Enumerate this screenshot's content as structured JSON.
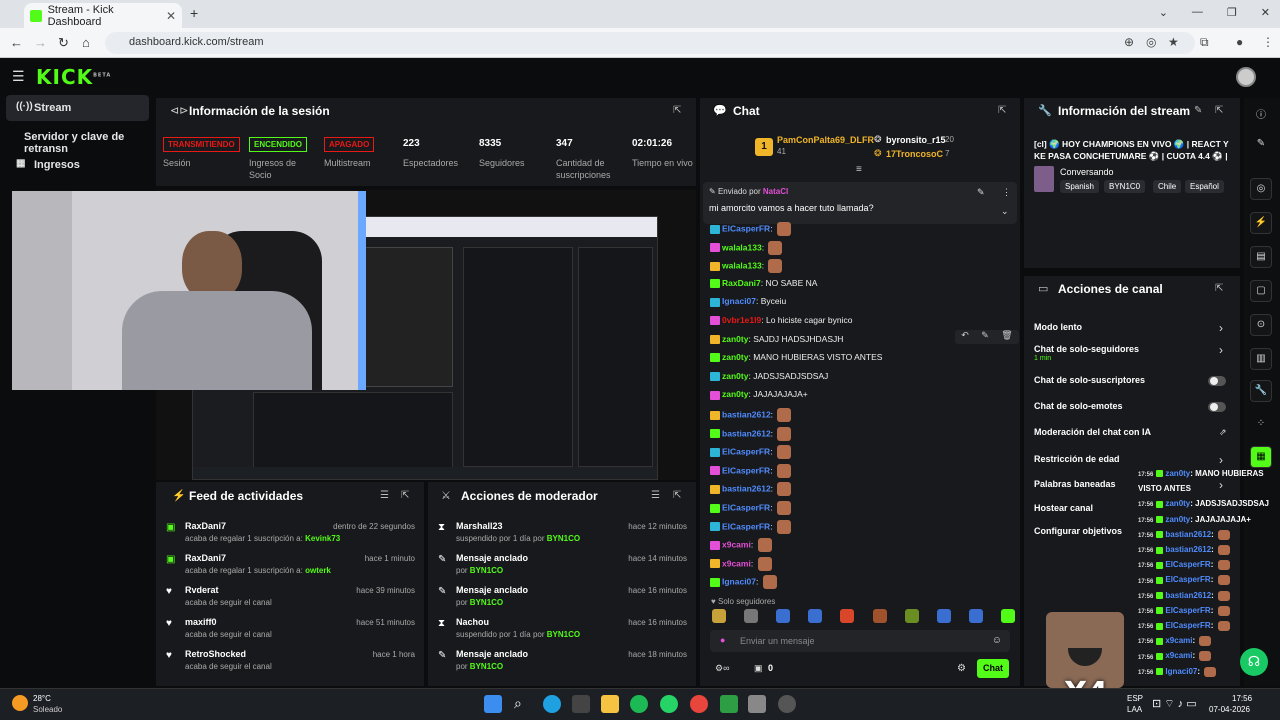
{
  "browser": {
    "tab_title": "Stream - Kick Dashboard",
    "url": "dashboard.kick.com/stream"
  },
  "brand": {
    "logo": "KICK",
    "logo_sup": "BETA",
    "accent": "#53fc18"
  },
  "sidebar": {
    "items": [
      {
        "label": "Stream",
        "icon": "broadcast-icon"
      },
      {
        "label": "Servidor y clave de retransn",
        "icon": ""
      },
      {
        "label": "Ingresos",
        "icon": "grid-icon"
      }
    ]
  },
  "session": {
    "title": "Información de la sesión",
    "stats": [
      {
        "badge": "TRANSMITIENDO",
        "label": "Sesión",
        "color": "#e91916"
      },
      {
        "badge": "ENCENDIDO",
        "label": "Ingresos de Socio",
        "color": "#53fc18"
      },
      {
        "badge": "APAGADO",
        "label": "Multistream",
        "color": "#e91916"
      },
      {
        "value": "223",
        "label": "Espectadores"
      },
      {
        "value": "8335",
        "label": "Seguidores"
      },
      {
        "value": "347",
        "label": "Cantidad de suscripciones"
      },
      {
        "value": "02:01:26",
        "label": "Tiempo en vivo"
      }
    ]
  },
  "feed": {
    "title": "Feed de actividades",
    "items": [
      {
        "name": "RaxDani7",
        "desc": "acaba de regalar 1 suscripción a:",
        "target": "Kevink73",
        "time": "dentro de 22 segundos",
        "icon": "gift-icon"
      },
      {
        "name": "RaxDani7",
        "desc": "acaba de regalar 1 suscripción a:",
        "target": "owterk",
        "time": "hace 1 minuto",
        "icon": "gift-icon"
      },
      {
        "name": "Rvderat",
        "desc": "acaba de seguir el canal",
        "target": "",
        "time": "hace 39 minutos",
        "icon": "heart-icon"
      },
      {
        "name": "maxiff0",
        "desc": "acaba de seguir el canal",
        "target": "",
        "time": "hace 51 minutos",
        "icon": "heart-icon"
      },
      {
        "name": "RetroShocked",
        "desc": "acaba de seguir el canal",
        "target": "",
        "time": "hace 1 hora",
        "icon": "heart-icon"
      }
    ]
  },
  "moderator": {
    "title": "Acciones de moderador",
    "items": [
      {
        "name": "Marshall23",
        "desc": "suspendido por 1 día por",
        "by": "BYN1CO",
        "time": "hace 12 minutos",
        "icon": "hourglass-icon"
      },
      {
        "name": "Mensaje anclado",
        "desc": "por",
        "by": "BYN1CO",
        "time": "hace 14 minutos",
        "icon": "pin-icon"
      },
      {
        "name": "Mensaje anclado",
        "desc": "por",
        "by": "BYN1CO",
        "time": "hace 16 minutos",
        "icon": "pin-icon"
      },
      {
        "name": "Nachou",
        "desc": "suspendido por 1 día por",
        "by": "BYN1CO",
        "time": "hace 16 minutos",
        "icon": "hourglass-icon"
      },
      {
        "name": "Mensaje anclado",
        "desc": "por",
        "by": "BYN1CO",
        "time": "hace 18 minutos",
        "icon": "pin-icon"
      }
    ]
  },
  "chat": {
    "title": "Chat",
    "gifters": {
      "top": "PamConPalta69_DLFR",
      "top_count": "41",
      "second": "byronsito_r15",
      "second_count": "20",
      "third": "17TroncosoC",
      "third_count": "7",
      "rank": "1"
    },
    "pinned": {
      "label": "Enviado por",
      "user": "NataCl",
      "text": "mi amorcito vamos a hacer tuto llamada?"
    },
    "messages": [
      {
        "user": "ElCasperFR",
        "color": "#4f8cff",
        "text": ""
      },
      {
        "user": "walala133",
        "color": "#53fc18",
        "text": ""
      },
      {
        "user": "walala133",
        "color": "#53fc18",
        "text": ""
      },
      {
        "user": "RaxDani7",
        "color": "#53fc18",
        "text": "NO SABE NA"
      },
      {
        "user": "Ignaci07",
        "color": "#4f8cff",
        "text": "Byceiu"
      },
      {
        "user": "0vbr1e1l9",
        "color": "#e91916",
        "text": "Lo hiciste cagar bynico"
      },
      {
        "user": "zan0ty",
        "color": "#53fc18",
        "text": "SAJDJ HADSJHDASJH"
      },
      {
        "user": "zan0ty",
        "color": "#53fc18",
        "text": "MANO HUBIERAS VISTO ANTES"
      },
      {
        "user": "zan0ty",
        "color": "#53fc18",
        "text": "JADSJSADJSDSAJ"
      },
      {
        "user": "zan0ty",
        "color": "#53fc18",
        "text": "JAJAJAJAJA+"
      },
      {
        "user": "bastian2612",
        "color": "#4f8cff",
        "text": ""
      },
      {
        "user": "bastian2612",
        "color": "#4f8cff",
        "text": ""
      },
      {
        "user": "ElCasperFR",
        "color": "#4f8cff",
        "text": ""
      },
      {
        "user": "ElCasperFR",
        "color": "#4f8cff",
        "text": ""
      },
      {
        "user": "bastian2612",
        "color": "#4f8cff",
        "text": ""
      },
      {
        "user": "ElCasperFR",
        "color": "#4f8cff",
        "text": ""
      },
      {
        "user": "ElCasperFR",
        "color": "#4f8cff",
        "text": ""
      },
      {
        "user": "x9cami",
        "color": "#e34fd6",
        "text": ""
      },
      {
        "user": "x9cami",
        "color": "#e34fd6",
        "text": ""
      },
      {
        "user": "Ignaci07",
        "color": "#4f8cff",
        "text": ""
      }
    ],
    "mode": "Solo seguidores",
    "input_placeholder": "Enviar un mensaje",
    "points": "0",
    "send": "Chat"
  },
  "stream_info": {
    "title": "Información del stream",
    "stream_title": "[cl] 🌍 HOY CHAMPIONS EN VIVO 🌍 | REACT Y KE PASA CONCHETUMARE ⚽ | CUOTA 4.4 ⚽ | ...",
    "category": "Conversando",
    "tags": [
      "Spanish",
      "BYN1C0",
      "Chile",
      "Español"
    ]
  },
  "channel_actions": {
    "title": "Acciones de canal",
    "items": [
      {
        "label": "Modo lento",
        "type": "arrow",
        "sub": ""
      },
      {
        "label": "Chat de solo-seguidores",
        "type": "arrow",
        "sub": "1 min"
      },
      {
        "label": "Chat de solo-suscriptores",
        "type": "toggle",
        "sub": ""
      },
      {
        "label": "Chat de solo-emotes",
        "type": "toggle",
        "sub": ""
      },
      {
        "label": "Moderación del chat con IA",
        "type": "link",
        "sub": ""
      },
      {
        "label": "Restricción de edad",
        "type": "arrow",
        "sub": ""
      },
      {
        "label": "Palabras baneadas",
        "type": "arrow",
        "sub": ""
      },
      {
        "label": "Hostear canal",
        "type": "none",
        "sub": ""
      },
      {
        "label": "Configurar objetivos",
        "type": "none",
        "sub": ""
      }
    ]
  },
  "overlay_chat": [
    {
      "user": "zan0ty",
      "text": "MANO HUBIERAS"
    },
    {
      "user": "",
      "text": "VISTO ANTES"
    },
    {
      "user": "zan0ty",
      "text": "JADSJSADJSDSAJ"
    },
    {
      "user": "zan0ty",
      "text": "JAJAJAJAJA+"
    },
    {
      "user": "bastian2612",
      "text": ""
    },
    {
      "user": "bastian2612",
      "text": ""
    },
    {
      "user": "ElCasperFR",
      "text": ""
    },
    {
      "user": "ElCasperFR",
      "text": ""
    },
    {
      "user": "bastian2612",
      "text": ""
    },
    {
      "user": "ElCasperFR",
      "text": ""
    },
    {
      "user": "ElCasperFR",
      "text": ""
    },
    {
      "user": "x9cami",
      "text": ""
    },
    {
      "user": "x9cami",
      "text": ""
    },
    {
      "user": "Ignaci07",
      "text": ""
    }
  ],
  "overlay_time": "17:56",
  "multiplier": "X4",
  "taskbar": {
    "weather_temp": "28°C",
    "weather_desc": "Soleado",
    "lang1": "ESP",
    "lang2": "LAA",
    "time": "17:56",
    "date": "07-04-2026"
  }
}
